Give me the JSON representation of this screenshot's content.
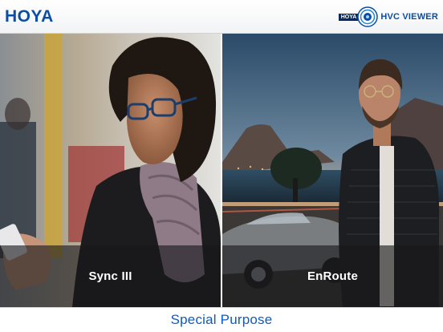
{
  "header": {
    "brand": "HOYA",
    "viewer_tag": "HOYA",
    "viewer_name": "HVC VIEWER"
  },
  "panels": [
    {
      "label": "Sync III",
      "scene": "woman-with-glasses-reading-phone"
    },
    {
      "label": "EnRoute",
      "scene": "man-with-glasses-by-convertible-car"
    }
  ],
  "footer": {
    "label": "Special Purpose"
  },
  "colors": {
    "brand_blue": "#0a4fa3",
    "footer_text": "#0a5cc2",
    "caption_overlay": "rgba(25,25,28,0.62)"
  }
}
